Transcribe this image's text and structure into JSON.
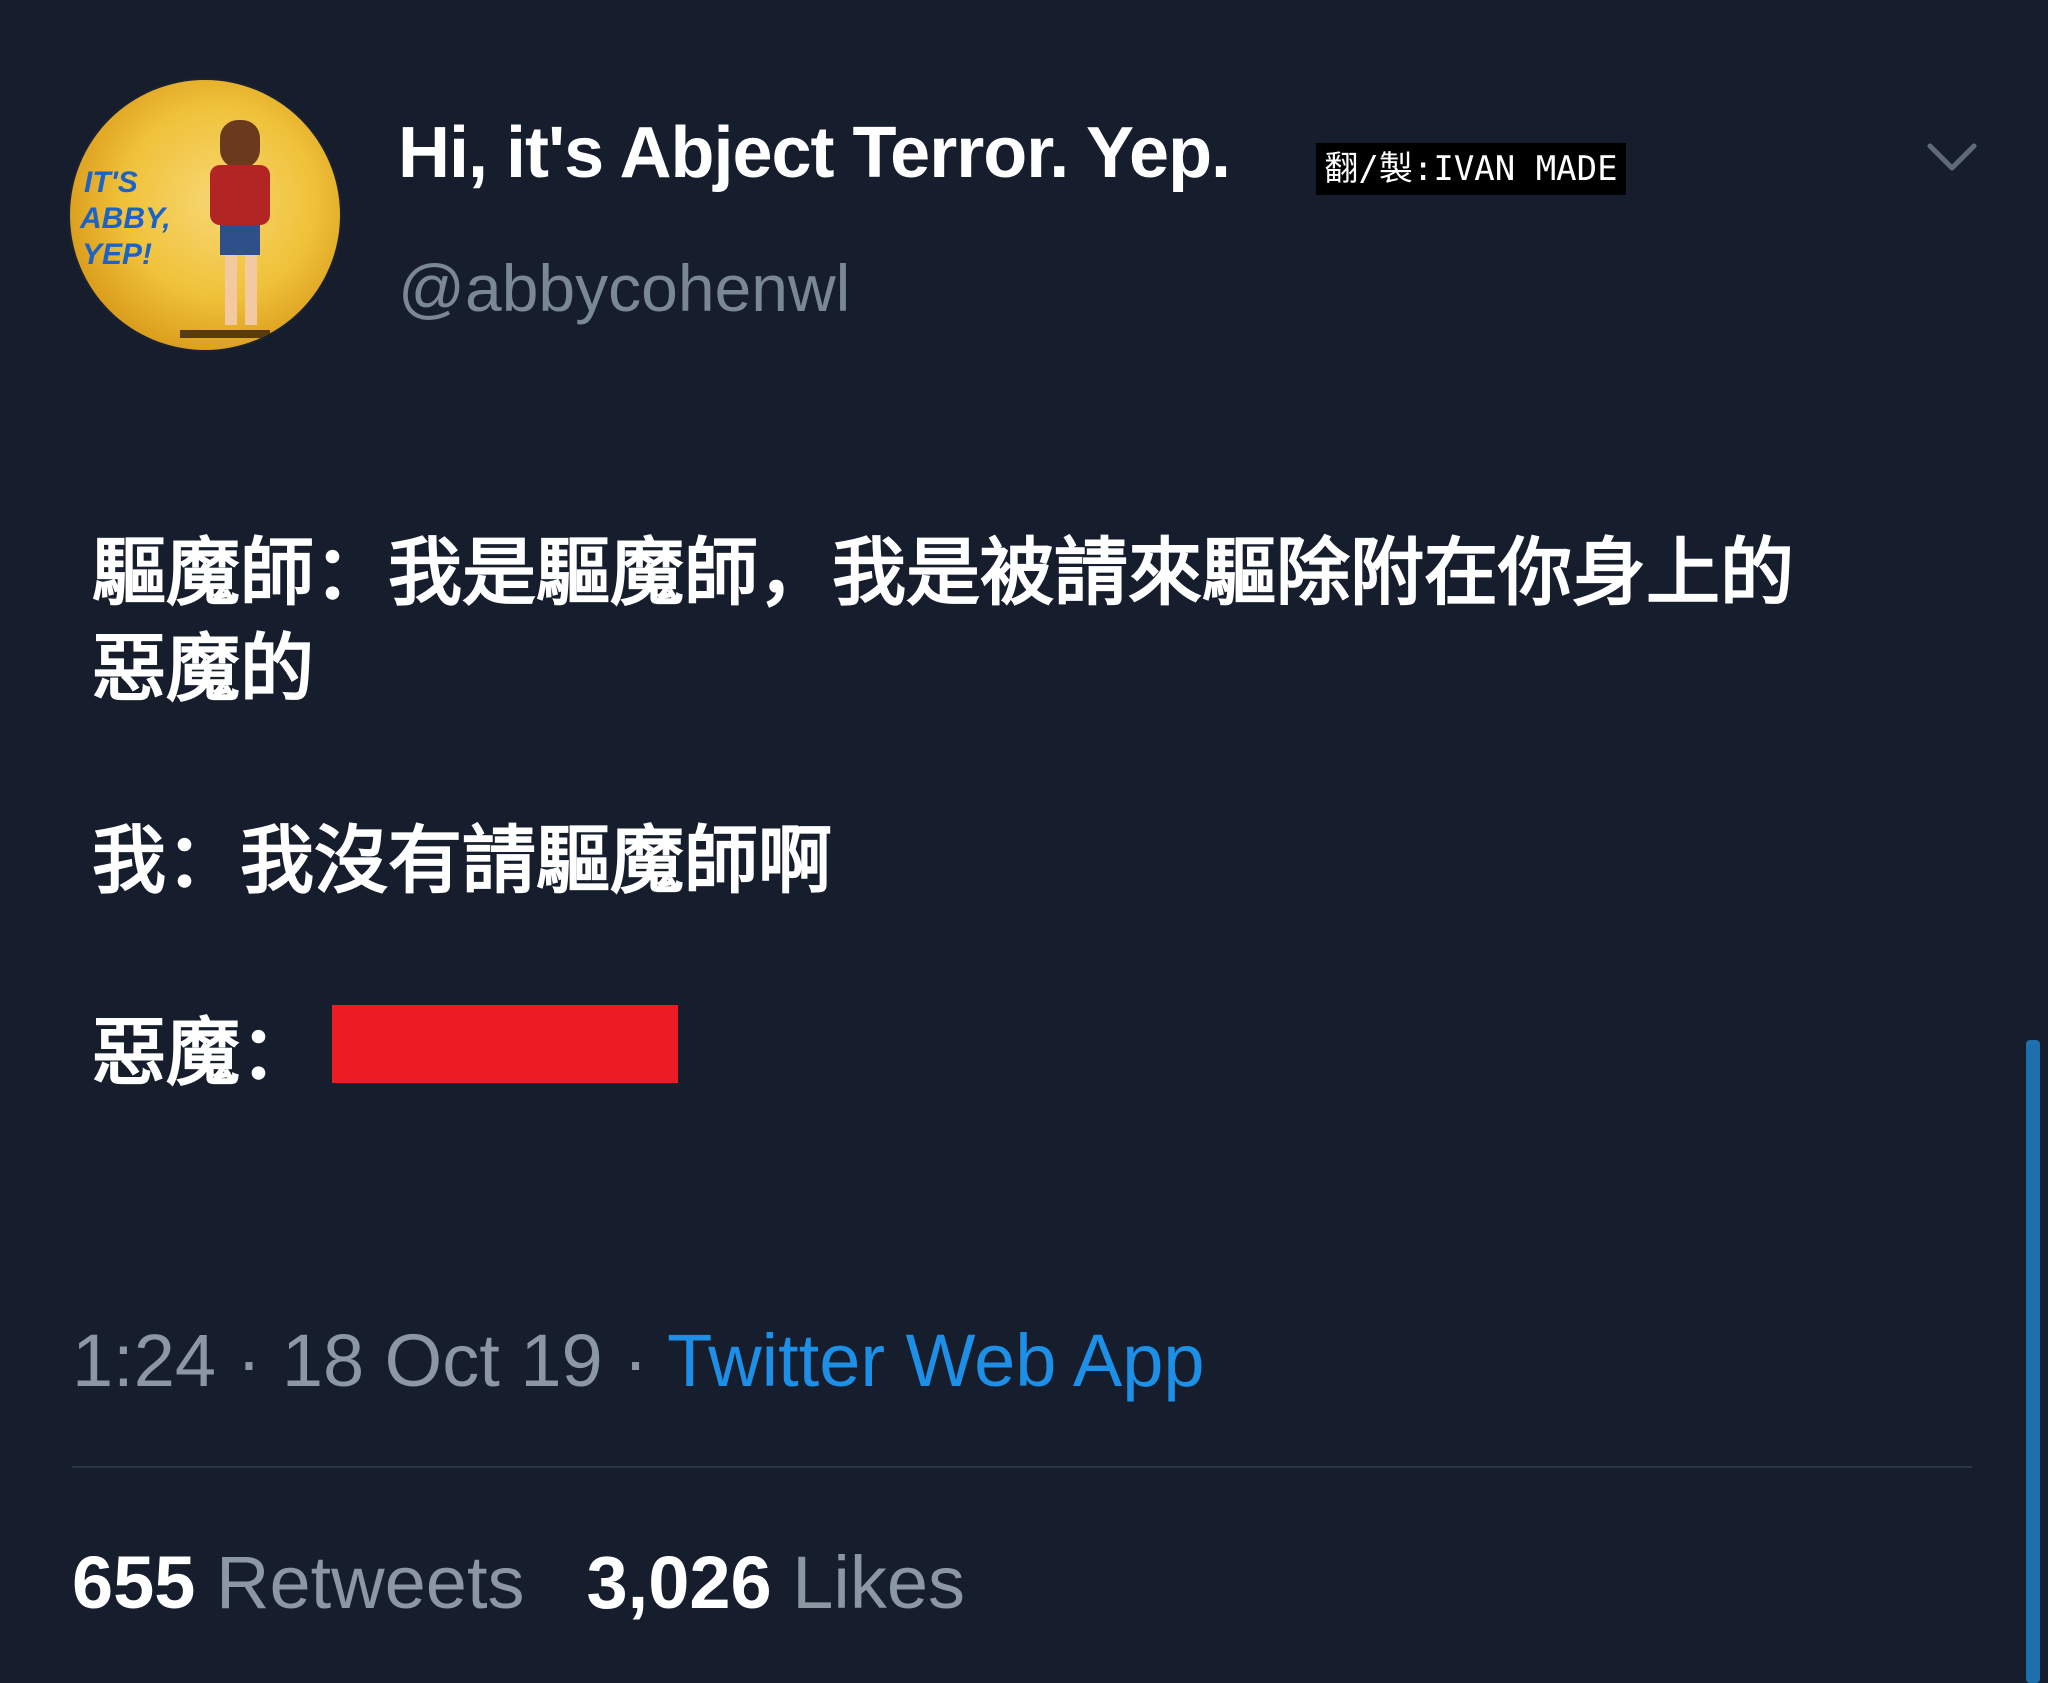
{
  "tweet": {
    "display_name": "Hi, it's Abject Terror. Yep.",
    "handle": "@abbycohenwl",
    "avatar_text": [
      "IT'S",
      "ABBY,",
      "YEP!"
    ],
    "watermark": "翻/製:IVAN MADE",
    "body": {
      "line1": "驅魔師：我是驅魔師，我是被請來驅除附在你身上的",
      "line1b": "惡魔的",
      "line2": "我：我沒有請驅魔師啊",
      "line3": "惡魔："
    },
    "time": "1:24",
    "date": "18 Oct 19",
    "separator": "·",
    "source": "Twitter Web App",
    "retweets_count": "655",
    "retweets_label": "Retweets",
    "likes_count": "3,026",
    "likes_label": "Likes"
  },
  "colors": {
    "background": "#161e2d",
    "redaction": "#ed1c24",
    "link": "#1e8fe6",
    "muted": "#8b97a3"
  },
  "icons": {
    "menu": "chevron-down-icon"
  }
}
